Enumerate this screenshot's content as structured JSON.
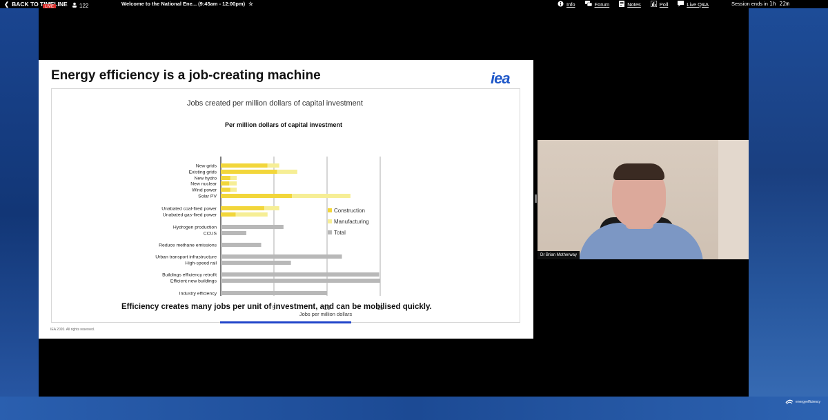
{
  "topbar": {
    "back_label": "BACK TO TIMELINE",
    "live_label": "LIVE",
    "viewer_count": "122",
    "session_title": "Welcome to the National Ene... (9:45am - 12:00pm)",
    "menu": [
      {
        "icon": "info-icon",
        "label": "Info"
      },
      {
        "icon": "forum-icon",
        "label": "Forum"
      },
      {
        "icon": "notes-icon",
        "label": "Notes"
      },
      {
        "icon": "poll-icon",
        "label": "Poll"
      },
      {
        "icon": "live-qa-icon",
        "label": "Live Q&A"
      }
    ],
    "session_ends_label": "Session ends in",
    "session_ends_time": "1h 22m"
  },
  "slide": {
    "title": "Energy efficiency is a job-creating machine",
    "logo": "iea",
    "chart_heading": "Jobs created per million dollars of capital investment",
    "caption": "Efficiency creates many jobs per unit of investment, and can be mobilised quickly.",
    "footer": "IEA 2020. All rights reserved."
  },
  "chart_data": {
    "type": "bar",
    "orientation": "horizontal",
    "stacked": true,
    "title": "Per million dollars of capital investment",
    "xlabel": "Jobs per million dollars",
    "xlim": [
      0,
      15
    ],
    "xticks": [
      5,
      10,
      15
    ],
    "grid": "vertical",
    "legend_position": "right",
    "colors": {
      "Construction": "#f2d63a",
      "Manufacturing": "#f6ee95",
      "Total": "#b8b8b8"
    },
    "categories": [
      "New grids",
      "Existing grids",
      "New hydro",
      "New nuclear",
      "Wind power",
      "Solar PV",
      "Unabated coal-fired power",
      "Unabated gas-fired power",
      "Hydrogen production",
      "CCUS",
      "Reduce methane emissions",
      "Urban transport infrastructure",
      "High-speed rail",
      "Buildings efficiency retrofit",
      "Efficient new buildings",
      "Industry efficiency"
    ],
    "series": [
      {
        "name": "Construction",
        "values": [
          4.4,
          5.3,
          0.9,
          0.8,
          0.9,
          6.7,
          4.1,
          1.4,
          null,
          null,
          null,
          null,
          null,
          null,
          null,
          null
        ]
      },
      {
        "name": "Manufacturing",
        "values": [
          1.1,
          1.9,
          0.6,
          0.7,
          0.6,
          5.5,
          1.4,
          3.0,
          null,
          null,
          null,
          null,
          null,
          null,
          null,
          null
        ]
      },
      {
        "name": "Total",
        "values": [
          null,
          null,
          null,
          null,
          null,
          null,
          null,
          null,
          5.9,
          2.4,
          3.8,
          11.4,
          6.6,
          14.9,
          15.0,
          10.0
        ]
      }
    ]
  },
  "video": {
    "speaker_name": "Dr Brian Motherway"
  },
  "branding": {
    "logo_text": "energyefficiency"
  }
}
